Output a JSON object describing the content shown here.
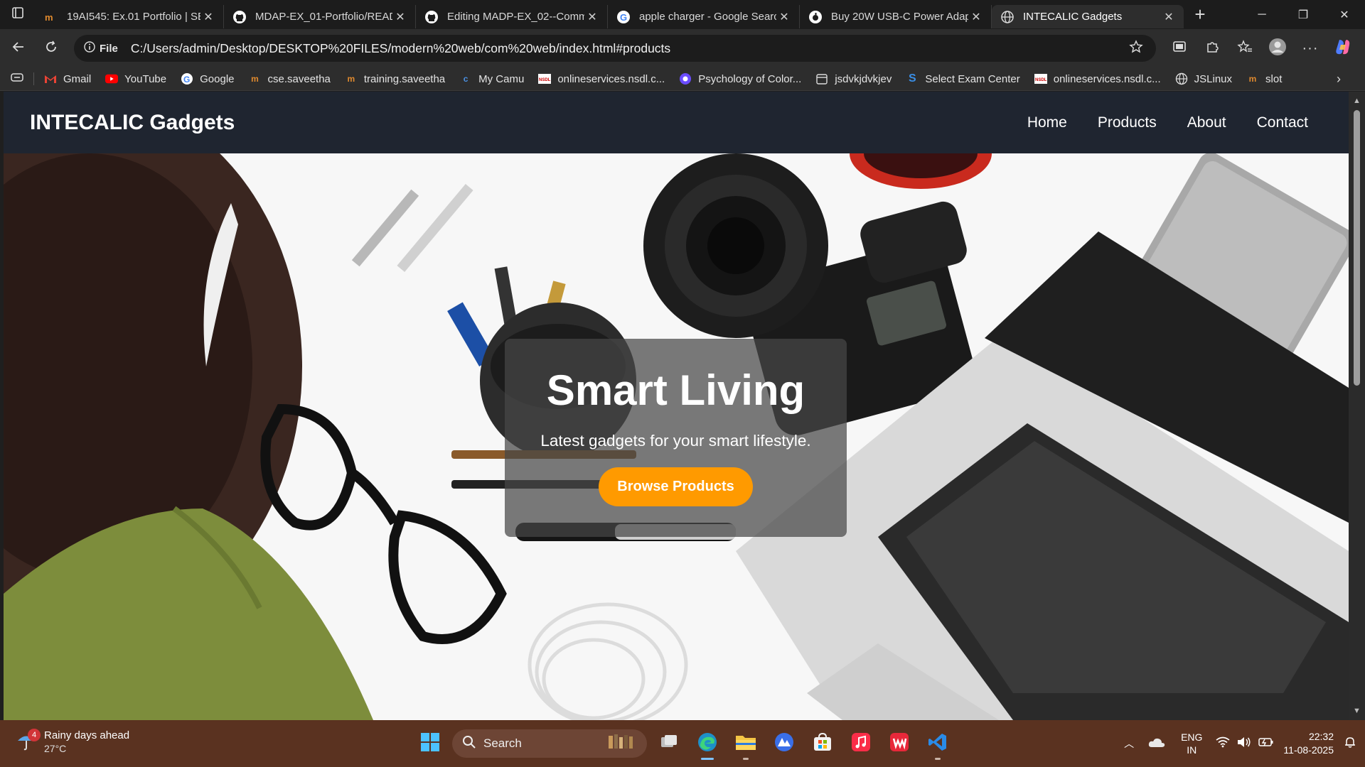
{
  "browser": {
    "tabs": [
      {
        "title": "19AI545: Ex.01 Portfolio | SEC",
        "icon": "site-favicon"
      },
      {
        "title": "MDAP-EX_01-Portfolio/README",
        "icon": "github-icon"
      },
      {
        "title": "Editing MADP-EX_02--Comm",
        "icon": "github-icon"
      },
      {
        "title": "apple charger - Google Search",
        "icon": "google-icon"
      },
      {
        "title": "Buy 20W USB-C Power Adapter",
        "icon": "apple-icon"
      },
      {
        "title": "INTECALIC Gadgets",
        "icon": "globe-icon",
        "active": true
      }
    ],
    "address": {
      "badge": "File",
      "url": "C:/Users/admin/Desktop/DESKTOP%20FILES/modern%20web/com%20web/index.html#products"
    },
    "bookmarks": [
      {
        "label": "Gmail",
        "icon": "gmail-icon"
      },
      {
        "label": "YouTube",
        "icon": "youtube-icon"
      },
      {
        "label": "Google",
        "icon": "google-icon"
      },
      {
        "label": "cse.saveetha",
        "icon": "saveetha-icon"
      },
      {
        "label": "training.saveetha",
        "icon": "saveetha-icon"
      },
      {
        "label": "My Camu",
        "icon": "camu-icon"
      },
      {
        "label": "onlineservices.nsdl.c...",
        "icon": "nsdl-icon"
      },
      {
        "label": "Psychology of Color...",
        "icon": "color-icon"
      },
      {
        "label": "jsdvkjdvkjev",
        "icon": "calendar-icon"
      },
      {
        "label": "Select Exam Center",
        "icon": "exam-icon"
      },
      {
        "label": "onlineservices.nsdl.c...",
        "icon": "nsdl-icon"
      },
      {
        "label": "JSLinux",
        "icon": "globe-icon"
      },
      {
        "label": "slot",
        "icon": "saveetha-icon"
      }
    ]
  },
  "site": {
    "brand": "INTECALIC Gadgets",
    "nav": [
      "Home",
      "Products",
      "About",
      "Contact"
    ],
    "hero": {
      "title": "Smart Living",
      "subtitle": "Latest gadgets for your smart lifestyle.",
      "cta": "Browse Products"
    },
    "colors": {
      "nav_bg": "#1f2530",
      "cta": "#ff9a00"
    }
  },
  "taskbar": {
    "weather": {
      "headline": "Rainy days ahead",
      "temp": "27°C",
      "badge": "4"
    },
    "search_label": "Search",
    "lang": {
      "line1": "ENG",
      "line2": "IN"
    },
    "clock": {
      "time": "22:32",
      "date": "11-08-2025"
    }
  }
}
